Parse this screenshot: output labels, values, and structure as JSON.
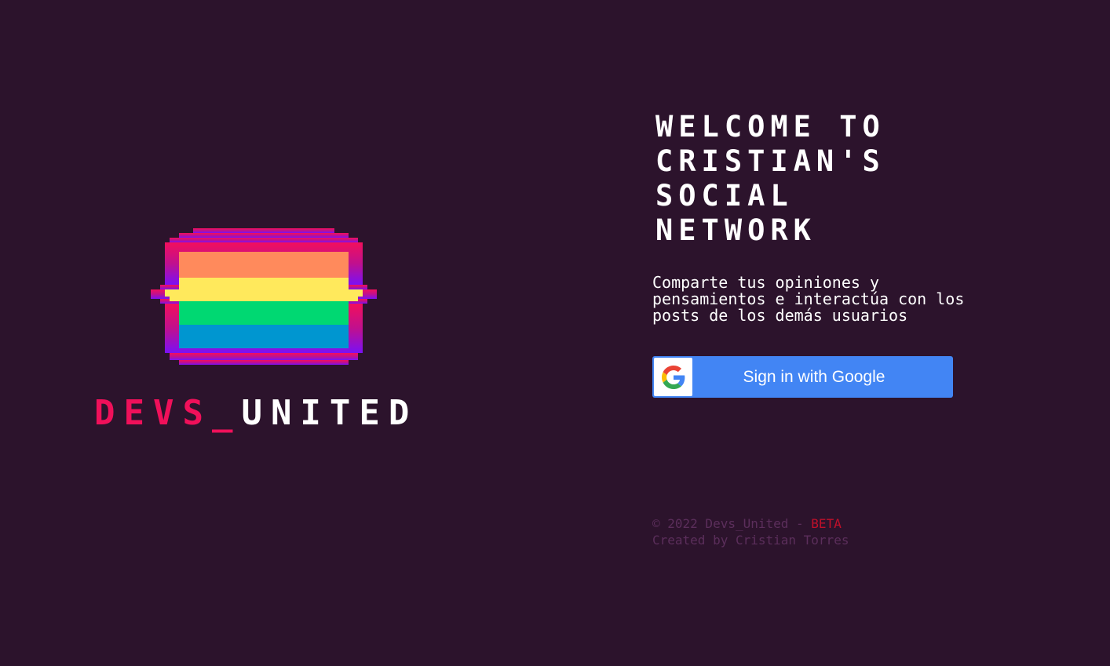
{
  "brand": {
    "part1": "DEVS_",
    "part2": "UNITED"
  },
  "welcome": {
    "title": "WELCOME TO CRISTIAN'S SOCIAL NETWORK",
    "subtitle": "Comparte tus opiniones y pensamientos e interactúa con los posts de los demás usuarios"
  },
  "signin": {
    "label": "Sign in with Google",
    "icon": "google-g-icon"
  },
  "footer": {
    "copyright": "© 2022 Devs_United - ",
    "beta": "BETA",
    "credit": "Created by Cristian Torres"
  },
  "colors": {
    "background": "#2c132c",
    "accent_pink": "#f0105a",
    "google_blue": "#4285f4",
    "beta_red": "#c0102a",
    "muted_text": "#5b2e5b"
  }
}
